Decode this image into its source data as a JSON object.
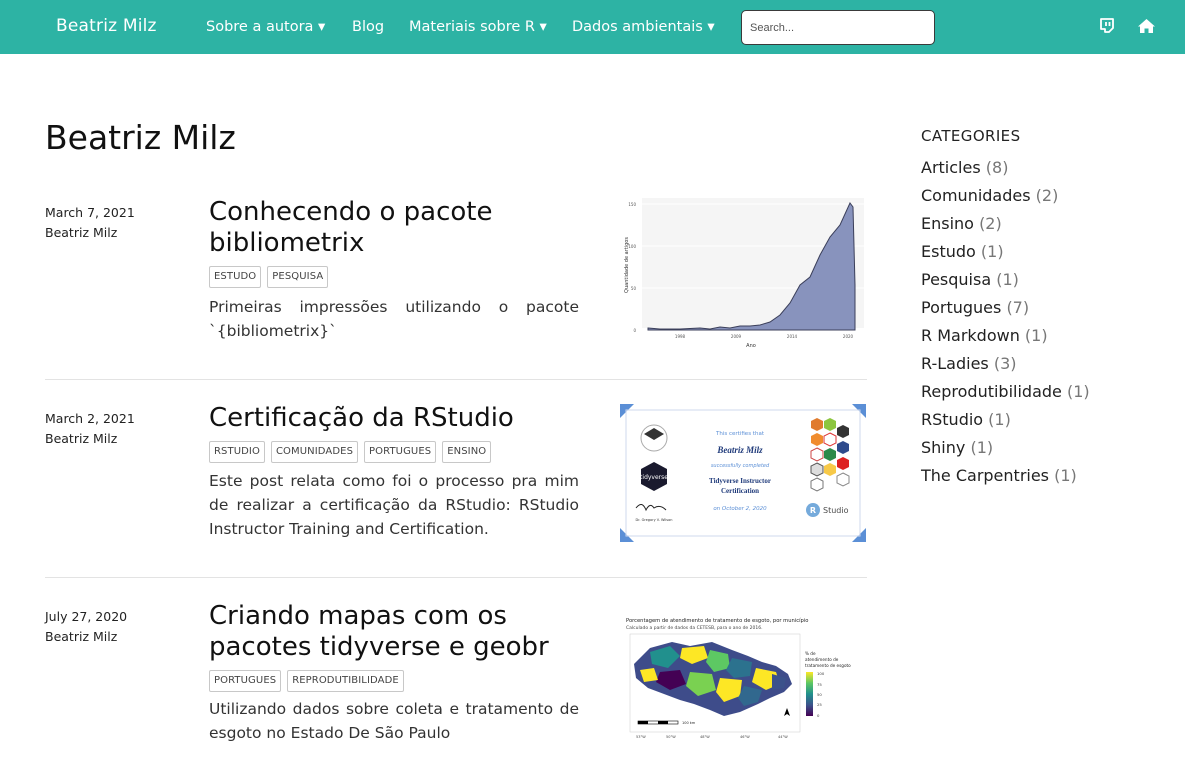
{
  "navbar": {
    "brand": "Beatriz Milz",
    "links": [
      {
        "label": "Sobre a autora ▾"
      },
      {
        "label": "Blog"
      },
      {
        "label": "Materiais sobre R ▾"
      },
      {
        "label": "Dados ambientais ▾"
      }
    ],
    "search_placeholder": "Search...",
    "icons": [
      "chat-bubble-icon",
      "home-icon"
    ]
  },
  "page_title": "Beatriz Milz",
  "posts": [
    {
      "date": "March 7, 2021",
      "author": "Beatriz Milz",
      "title": "Conhecendo o pacote bibliometrix",
      "tags": [
        "ESTUDO",
        "PESQUISA"
      ],
      "summary": "Primeiras impressões utilizando o pacote `{bibliometrix}`"
    },
    {
      "date": "March 2, 2021",
      "author": "Beatriz Milz",
      "title": "Certificação da RStudio",
      "tags": [
        "RSTUDIO",
        "COMUNIDADES",
        "PORTUGUES",
        "ENSINO"
      ],
      "summary": "Este post relata como foi o processo pra mim de realizar a certificação da RStudio: RStudio Instructor Training and Certification."
    },
    {
      "date": "July 27, 2020",
      "author": "Beatriz Milz",
      "title": "Criando mapas com os pacotes tidyverse e geobr",
      "tags": [
        "PORTUGUES",
        "REPRODUTIBILIDADE"
      ],
      "summary": "Utilizando dados sobre coleta e tratamento de esgoto no Estado De São Paulo"
    }
  ],
  "thumb1": {
    "ylabel": "Quantidade de artigos",
    "xlabel": "Ano",
    "yticks": [
      "150",
      "100",
      "50",
      "0"
    ],
    "xticks": [
      "1998",
      "2009",
      "2014",
      "2020"
    ]
  },
  "thumb2": {
    "cert_of": "This certifies that",
    "name": "Beatriz Milz",
    "completed": "successfully completed",
    "course_line1": "Tidyverse Instructor",
    "course_line2": "Certification",
    "date": "on October 2, 2020",
    "signer": "Dr. Gregory V. Wilson",
    "badge_text": "tidyverse",
    "rstudio_text": "Studio"
  },
  "thumb3": {
    "title": "Porcentagem de atendimento de tratamento de esgoto, por município",
    "subtitle": "Calculado a partir de dados da CETESB, para o ano de 2016.",
    "legend_title": "% de atendimento de tratamento de esgoto",
    "legend_ticks": [
      "100",
      "75",
      "50",
      "25",
      "0"
    ],
    "scale_label": "100 km",
    "x_ticks": [
      "53°W",
      "50°W",
      "48°W",
      "46°W",
      "44°W"
    ]
  },
  "sidebar": {
    "heading": "CATEGORIES",
    "categories": [
      {
        "name": "Articles",
        "count": "(8)"
      },
      {
        "name": "Comunidades",
        "count": "(2)"
      },
      {
        "name": "Ensino",
        "count": "(2)"
      },
      {
        "name": "Estudo",
        "count": "(1)"
      },
      {
        "name": "Pesquisa",
        "count": "(1)"
      },
      {
        "name": "Portugues",
        "count": "(7)"
      },
      {
        "name": "R Markdown",
        "count": "(1)"
      },
      {
        "name": "R-Ladies",
        "count": "(3)"
      },
      {
        "name": "Reprodutibilidade",
        "count": "(1)"
      },
      {
        "name": "RStudio",
        "count": "(1)"
      },
      {
        "name": "Shiny",
        "count": "(1)"
      },
      {
        "name": "The Carpentries",
        "count": "(1)"
      }
    ]
  },
  "colors": {
    "navbar": "#2db3a4",
    "chart_fill": "#8893bd",
    "cert_frame": "#5b8fd6"
  }
}
